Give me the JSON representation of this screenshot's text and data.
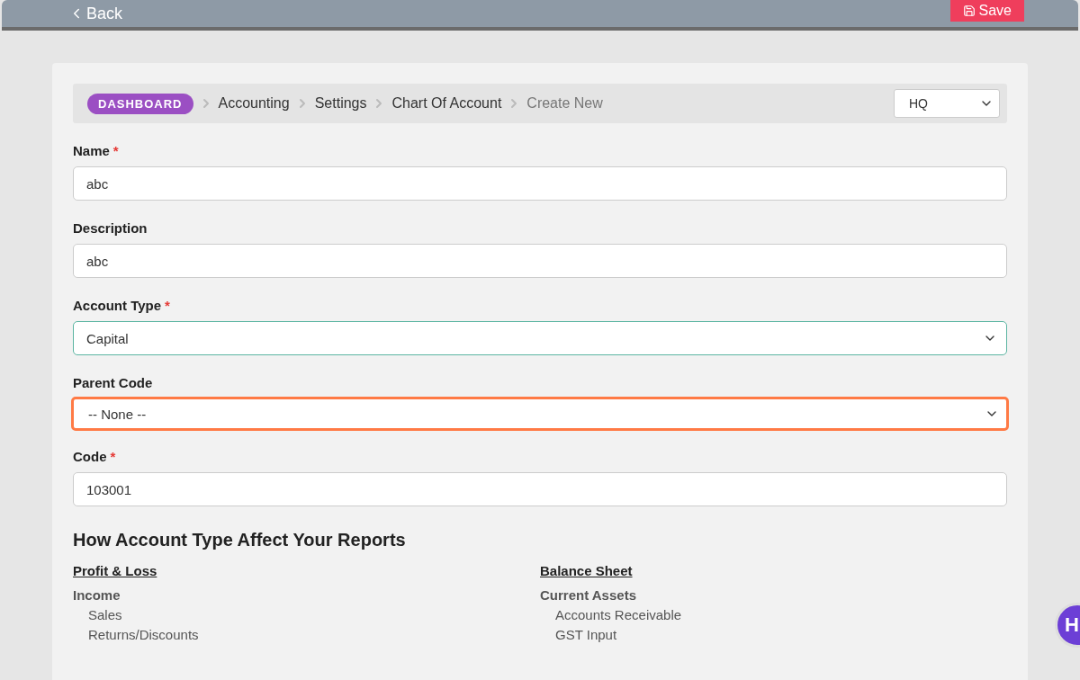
{
  "header": {
    "back": "Back",
    "save": "Save"
  },
  "breadcrumb": {
    "items": [
      {
        "label": "DASHBOARD",
        "kind": "pill"
      },
      {
        "label": "Accounting",
        "kind": "link"
      },
      {
        "label": "Settings",
        "kind": "link"
      },
      {
        "label": "Chart Of Account",
        "kind": "link"
      },
      {
        "label": "Create New",
        "kind": "current"
      }
    ],
    "branch": "HQ"
  },
  "fields": [
    {
      "label": "Name",
      "required_mark": "*",
      "kind": "input",
      "value": "abc",
      "focused": false,
      "highlighted": false
    },
    {
      "label": "Description",
      "kind": "input",
      "value": "abc",
      "focused": false,
      "highlighted": false
    },
    {
      "label": "Account Type",
      "required_mark": "*",
      "kind": "select",
      "value": "Capital",
      "focused": true,
      "highlighted": false
    },
    {
      "label": "Parent Code",
      "kind": "select",
      "value": "-- None --",
      "focused": false,
      "highlighted": true
    },
    {
      "label": "Code",
      "required_mark": "*",
      "kind": "input",
      "value": "103001",
      "focused": false,
      "highlighted": false
    }
  ],
  "reports": {
    "title": "How Account Type Affect Your Reports",
    "columns": [
      {
        "heading": "Profit & Loss",
        "groups": [
          {
            "name": "Income",
            "items": [
              "Sales",
              "Returns/Discounts"
            ]
          }
        ]
      },
      {
        "heading": "Balance Sheet",
        "groups": [
          {
            "name": "Current Assets",
            "items": [
              "Accounts Receivable",
              "GST Input"
            ]
          }
        ]
      }
    ]
  },
  "help": {
    "label": "H"
  }
}
